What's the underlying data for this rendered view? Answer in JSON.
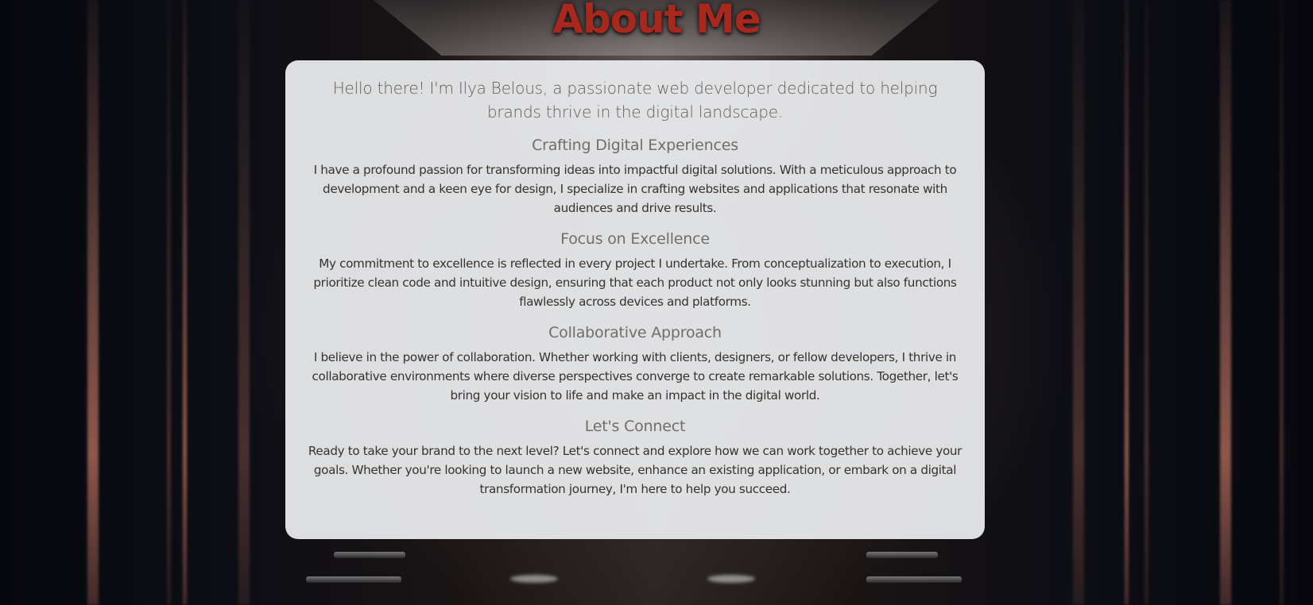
{
  "page": {
    "title": "About Me",
    "title_color": "#a8281e"
  },
  "card": {
    "intro": "Hello there! I'm Ilya Belous, a passionate web developer dedicated to helping brands thrive in the digital landscape.",
    "sections": [
      {
        "heading": "Crafting Digital Experiences",
        "body": "I have a profound passion for transforming ideas into impactful digital solutions. With a meticulous approach to development and a keen eye for design, I specialize in crafting websites and applications that resonate with audiences and drive results."
      },
      {
        "heading": "Focus on Excellence",
        "body": "My commitment to excellence is reflected in every project I undertake. From conceptualization to execution, I prioritize clean code and intuitive design, ensuring that each product not only looks stunning but also functions flawlessly across devices and platforms."
      },
      {
        "heading": "Collaborative Approach",
        "body": "I believe in the power of collaboration. Whether working with clients, designers, or fellow developers, I thrive in collaborative environments where diverse perspectives converge to create remarkable solutions. Together, let's bring your vision to life and make an impact in the digital world."
      },
      {
        "heading": "Let's Connect",
        "body": "Ready to take your brand to the next level? Let's connect and explore how we can work together to achieve your goals. Whether you're looking to launch a new website, enhance an existing application, or embark on a digital transformation journey, I'm here to help you succeed."
      }
    ]
  }
}
